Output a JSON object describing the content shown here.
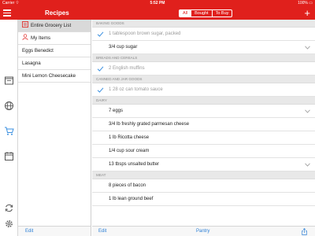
{
  "status_bar": {
    "carrier": "Carrier ⌔",
    "time": "5:52 PM",
    "battery": "100% ▭"
  },
  "nav": {
    "title": "Recipes",
    "segments": [
      {
        "label": "All",
        "active": true
      },
      {
        "label": "Bought",
        "active": false
      },
      {
        "label": "To Buy",
        "active": false
      }
    ],
    "add_label": "+"
  },
  "rail_icons": [
    "menu-icon",
    "recipe-book-icon",
    "globe-icon",
    "cart-icon",
    "calendar-icon",
    "sync-icon",
    "settings-icon"
  ],
  "lists": [
    {
      "label": "Entire Grocery List",
      "icon": "list-icon",
      "selected": true
    },
    {
      "label": "My Items",
      "icon": "person-icon",
      "selected": false
    },
    {
      "label": "Eggs Benedict",
      "selected": false
    },
    {
      "label": "Lasagna",
      "selected": false
    },
    {
      "label": "Mini Lemon Cheesecake",
      "selected": false
    }
  ],
  "sections": [
    {
      "title": "BAKING GOODS",
      "items": [
        {
          "text": "1 tablespoon brown sugar, packed",
          "checked": true
        },
        {
          "text": "3/4 cup sugar",
          "checked": false,
          "expandable": true
        }
      ]
    },
    {
      "title": "BREADS AND CEREALS",
      "items": [
        {
          "text": "2 English muffins",
          "checked": true
        }
      ]
    },
    {
      "title": "CANNED AND JAR GOODS",
      "items": [
        {
          "text": "1 28 oz can tomato sauce",
          "checked": true
        }
      ]
    },
    {
      "title": "DAIRY",
      "items": [
        {
          "text": "7 eggs",
          "checked": false,
          "expandable": true
        },
        {
          "text": "3/4 lb freshly grated parmesan cheese",
          "checked": false
        },
        {
          "text": "1 lb Ricotta cheese",
          "checked": false
        },
        {
          "text": "1/4 cup sour cream",
          "checked": false
        },
        {
          "text": "13 tbsps unsalted butter",
          "checked": false,
          "expandable": true
        }
      ]
    },
    {
      "title": "MEAT",
      "items": [
        {
          "text": "8 pieces of bacon",
          "checked": false
        },
        {
          "text": "1 lb lean ground beef",
          "checked": false
        }
      ]
    }
  ],
  "bottom_left": {
    "edit_label": "Edit"
  },
  "bottom_main": {
    "edit_label": "Edit",
    "pantry_label": "Pantry"
  },
  "colors": {
    "brand_red": "#e0201c",
    "link_blue": "#2b7fd6",
    "check_blue": "#3a8fe0"
  }
}
